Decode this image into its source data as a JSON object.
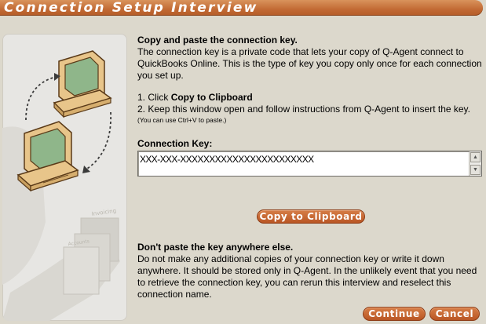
{
  "window": {
    "title": "Connection Setup Interview"
  },
  "intro": {
    "heading": "Copy and paste the connection key.",
    "body": "The connection key is a private code that lets your copy of Q-Agent connect to QuickBooks Online. This is the type of key you copy only once for each connection you set up."
  },
  "steps": {
    "step1_prefix": "1. Click ",
    "step1_bold": "Copy to Clipboard",
    "step2": "2. Keep this window open and follow instructions from Q-Agent to insert the key.",
    "hint": "(You can use Ctrl+V to paste.)"
  },
  "key": {
    "label": "Connection Key:",
    "value": "XXX-XXX-XXXXXXXXXXXXXXXXXXXXXXX"
  },
  "buttons": {
    "copy": "Copy to Clipboard",
    "continue": "Continue",
    "cancel": "Cancel"
  },
  "warning": {
    "heading": "Don't paste the key anywhere else.",
    "body": "Do not make any additional copies of your connection key or write it down anywhere. It should be stored only in Q-Agent. In the unlikely event that you need to retrieve the connection key, you can rerun this interview and reselect this connection name."
  },
  "illustration": {
    "label_top": "Invoicing",
    "label_bottom": "Accounts"
  },
  "colors": {
    "accent": "#c26a34",
    "background": "#dcd8cc",
    "panel": "#e7e6e3"
  }
}
